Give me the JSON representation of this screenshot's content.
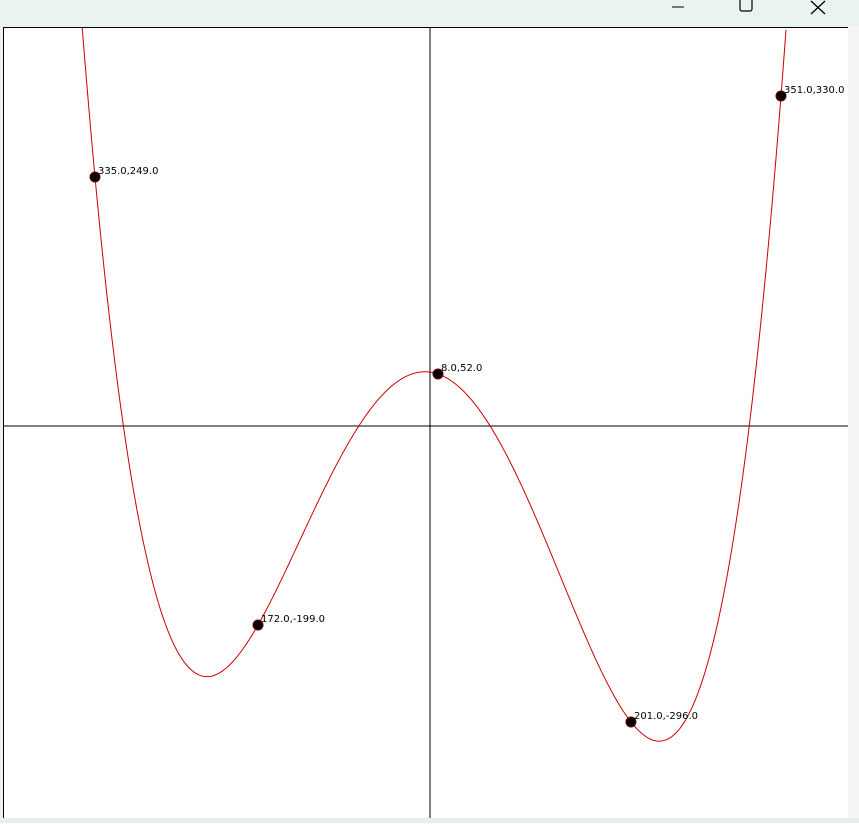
{
  "window": {
    "controls": {
      "minimize_icon": "minimize-icon",
      "maximize_icon": "maximize-icon",
      "close_icon": "close-icon"
    }
  },
  "chart_data": {
    "type": "line",
    "title": "",
    "xlabel": "",
    "ylabel": "",
    "xlim": [
      -428,
      417
    ],
    "ylim": [
      -390,
      400
    ],
    "grid": false,
    "axes_lines": true,
    "curve_color": "#cc0000",
    "point_color": "#000000",
    "curve_description": "interpolating polynomial through the control points",
    "points": [
      {
        "x": -335.0,
        "y": 249.0,
        "label": "-335.0,249.0"
      },
      {
        "x": -172.0,
        "y": -199.0,
        "label": "-172.0,-199.0"
      },
      {
        "x": 8.0,
        "y": 52.0,
        "label": "8.0,52.0"
      },
      {
        "x": 201.0,
        "y": -296.0,
        "label": "201.0,-296.0"
      },
      {
        "x": 351.0,
        "y": 330.0,
        "label": "351.0,330.0"
      }
    ],
    "visible_point_labels": [
      "335.0,249.0",
      "172.0,-199.0",
      "8.0,52.0",
      "201.0,-296.0",
      "351.0,330.0"
    ]
  }
}
